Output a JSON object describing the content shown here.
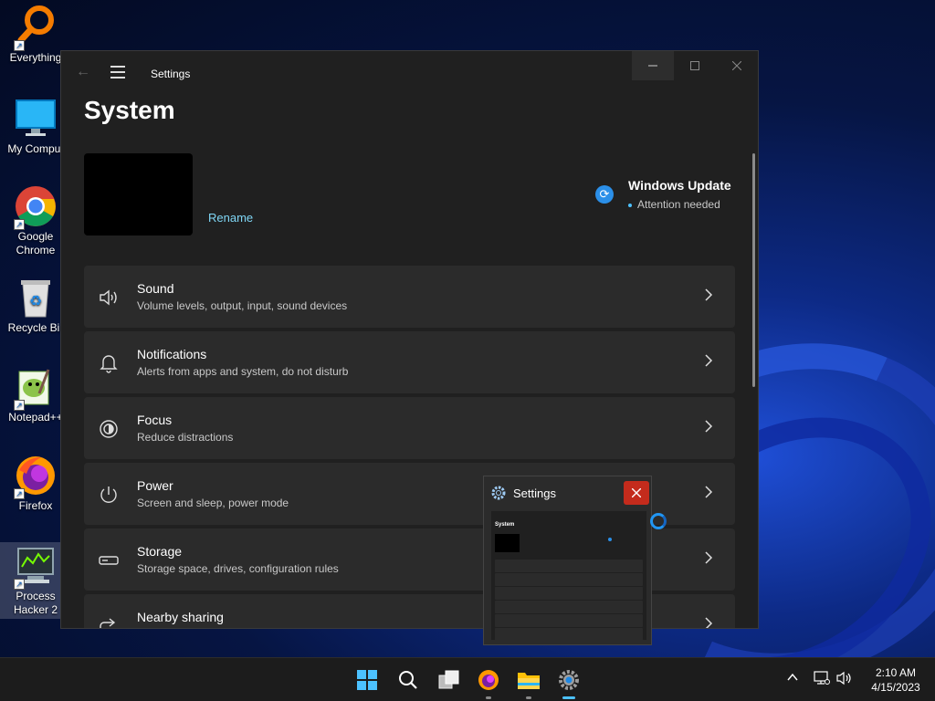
{
  "desktop": {
    "icons": [
      {
        "label": "Everything"
      },
      {
        "label": "My Comput"
      },
      {
        "label": "Google\nChrome",
        "line1": "Google",
        "line2": "Chrome"
      },
      {
        "label": "Recycle Bir"
      },
      {
        "label": "Notepad++"
      },
      {
        "label": "Firefox"
      },
      {
        "label": "Process Hacker 2",
        "line1": "Process",
        "line2": "Hacker 2"
      }
    ]
  },
  "window": {
    "title": "Settings",
    "page_title": "System",
    "rename_label": "Rename",
    "windows_update": {
      "title": "Windows Update",
      "status": "Attention needed"
    },
    "items": [
      {
        "title": "Sound",
        "subtitle": "Volume levels, output, input, sound devices",
        "icon": "speaker-icon"
      },
      {
        "title": "Notifications",
        "subtitle": "Alerts from apps and system, do not disturb",
        "icon": "bell-icon"
      },
      {
        "title": "Focus",
        "subtitle": "Reduce distractions",
        "icon": "focus-icon"
      },
      {
        "title": "Power",
        "subtitle": "Screen and sleep, power mode",
        "icon": "power-icon"
      },
      {
        "title": "Storage",
        "subtitle": "Storage space, drives, configuration rules",
        "icon": "storage-icon"
      },
      {
        "title": "Nearby sharing",
        "subtitle": "",
        "icon": "share-icon"
      }
    ]
  },
  "preview": {
    "title": "Settings",
    "mini_title": "System"
  },
  "taskbar": {
    "apps": [
      "start-icon",
      "search-icon",
      "task-view-icon",
      "firefox-icon",
      "file-explorer-icon",
      "settings-icon"
    ],
    "time": "2:10 AM",
    "date": "4/15/2023"
  },
  "colors": {
    "accent": "#4cc2ff",
    "link": "#7fd6f5",
    "close_red": "#c42b1c",
    "window_bg": "#202020",
    "card_bg": "#2b2b2b"
  }
}
